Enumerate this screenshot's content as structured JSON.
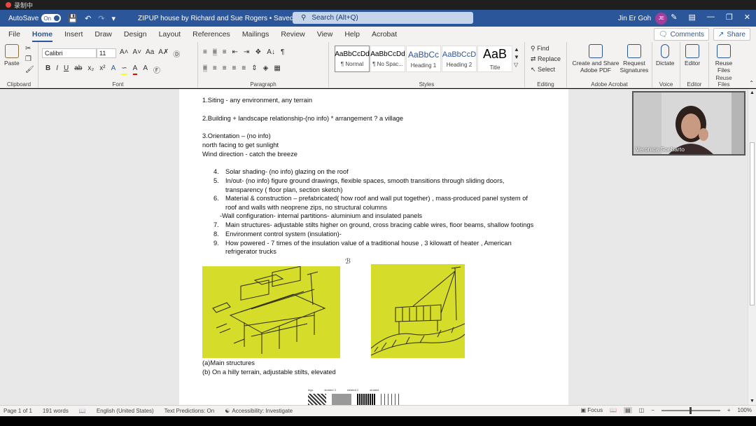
{
  "recording": {
    "label": "录制中"
  },
  "titlebar": {
    "autosave_label": "AutoSave",
    "autosave_state": "On",
    "doc_title": "ZIPUP house by Richard and Sue Rogers • Saved",
    "search_placeholder": "Search (Alt+Q)",
    "user_name": "Jin Er Goh",
    "user_initials": "JE"
  },
  "menu": {
    "tabs": [
      "File",
      "Home",
      "Insert",
      "Draw",
      "Design",
      "Layout",
      "References",
      "Mailings",
      "Review",
      "View",
      "Help",
      "Acrobat"
    ],
    "active": "Home",
    "comments_label": "Comments",
    "share_label": "Share"
  },
  "ribbon": {
    "clipboard": {
      "paste": "Paste",
      "group": "Clipboard"
    },
    "font": {
      "name": "Calibri",
      "size": "11",
      "group": "Font"
    },
    "paragraph": {
      "group": "Paragraph"
    },
    "styles": {
      "group": "Styles",
      "items": [
        {
          "preview": "AaBbCcDd",
          "name": "¶ Normal"
        },
        {
          "preview": "AaBbCcDd",
          "name": "¶ No Spac..."
        },
        {
          "preview": "AaBbCc",
          "name": "Heading 1"
        },
        {
          "preview": "AaBbCcD",
          "name": "Heading 2"
        },
        {
          "preview": "AaB",
          "name": "Title"
        }
      ]
    },
    "editing": {
      "find": "Find",
      "replace": "Replace",
      "select": "Select",
      "group": "Editing"
    },
    "acrobat": {
      "create": "Create and Share Adobe PDF",
      "request": "Request Signatures",
      "group": "Adobe Acrobat"
    },
    "voice": {
      "dictate": "Dictate",
      "group": "Voice"
    },
    "editor": {
      "editor": "Editor",
      "group": "Editor"
    },
    "reuse": {
      "reuse": "Reuse Files",
      "group": "Reuse Files"
    }
  },
  "document": {
    "line1": "1.Siting - any environment, any terrain",
    "line2": "2.Building + landscape relationship-(no info) * arrangement ? a village",
    "line3": " 3.Orientation – (no info)",
    "line4": "north facing to get sunlight",
    "line5": "Wind direction - catch the breeze",
    "items": [
      {
        "num": "4.",
        "text": "Solar shading- (no info) glazing on the roof"
      },
      {
        "num": "5.",
        "text": "In/out- (no info) figure ground drawings, flexible spaces, smooth transitions through sliding doors,"
      },
      {
        "num": "",
        "text": "transparency ( floor plan, section sketch)"
      },
      {
        "num": "6.",
        "text": "Material & construction – prefabricated( how roof and wall put together) , mass-produced panel system of"
      },
      {
        "num": "",
        "text": "roof and walls with neoprene zips, no structural columns"
      }
    ],
    "wall_config": "-Wall configuration- internal partitions- aluminium and insulated panels",
    "items2": [
      {
        "num": "7.",
        "text": "Main structures- adjustable stilts higher on ground, cross bracing cable wires, floor beams, shallow footings"
      },
      {
        "num": "8.",
        "text": "Environment control system (insulation)-"
      },
      {
        "num": "9.",
        "text": "How powered - 7 times of the insulation value of a traditional house , 3 kilowatt of heater , American"
      },
      {
        "num": "",
        "text": "refrigerator trucks"
      }
    ],
    "caption1": "(a)Main structures",
    "caption2": "(b) On a hilly terrain, adjustable stilts, elevated",
    "thumb_labels": [
      "legs",
      "striated 3",
      "striated 2",
      "striated"
    ]
  },
  "video": {
    "name": "Veronica Soebarto"
  },
  "status": {
    "page": "Page 1 of 1",
    "words": "191 words",
    "language": "English (United States)",
    "predictions": "Text Predictions: On",
    "accessibility": "Accessibility: Investigate",
    "focus": "Focus",
    "zoom": "100%"
  }
}
